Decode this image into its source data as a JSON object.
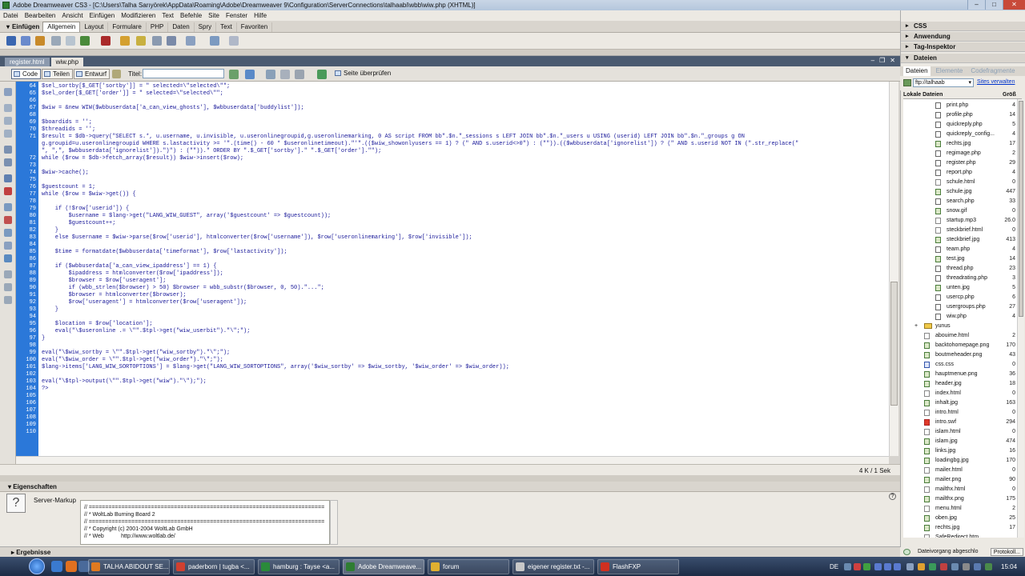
{
  "window": {
    "title": "Adobe Dreamweaver CS3 - [C:\\Users\\Talha Sarıyörek\\AppData\\Roaming\\Adobe\\Dreamweaver 9\\Configuration\\ServerConnections\\talhaabi\\wbb\\wiw.php (XHTML)]"
  },
  "menu": [
    "Datei",
    "Bearbeiten",
    "Ansicht",
    "Einfügen",
    "Modifizieren",
    "Text",
    "Befehle",
    "Site",
    "Fenster",
    "Hilfe"
  ],
  "insertbar": {
    "title": "Einfügen",
    "tabs": [
      "Allgemein",
      "Layout",
      "Formulare",
      "PHP",
      "Daten",
      "Spry",
      "Text",
      "Favoriten"
    ],
    "active": "Allgemein"
  },
  "doctabs": [
    "register.html",
    "wiw.php"
  ],
  "doctoolbar": {
    "code": "Code",
    "split": "Teilen",
    "design": "Entwurf",
    "title_label": "Titel:",
    "check": "Seite überprüfen"
  },
  "editor": {
    "line_numbers": [
      "64",
      "65",
      "66",
      "67",
      "68",
      "69",
      "70",
      "71",
      "",
      "",
      "72",
      "73",
      "74",
      "75",
      "76",
      "77",
      "78",
      "79",
      "80",
      "81",
      "82",
      "83",
      "84",
      "85",
      "86",
      "87",
      "88",
      "89",
      "90",
      "91",
      "92",
      "93",
      "94",
      "95",
      "96",
      "97",
      "98",
      "99",
      "100",
      "101",
      "102",
      "103",
      "104",
      "105",
      "106",
      "107",
      "108",
      "109",
      "110"
    ],
    "lines": [
      "$sel_sortby[$_GET['sortby']] = \" selected=\\\"selected\\\"\";",
      "$sel_order[$_GET['order']] = \" selected=\\\"selected\\\"\";",
      "",
      "$wiw = &new WIW($wbbuserdata['a_can_view_ghosts'], $wbbuserdata['buddylist']);",
      "",
      "$boardids = '';",
      "$threadids = '';",
      "$result = $db->query(\"SELECT s.*, u.username, u.invisible, u.useronlinegroupid,g.useronlinemarking, 0 AS script FROM bb\".$n.\"_sessions s LEFT JOIN bb\".$n.\"_users u USING (userid) LEFT JOIN bb\".$n.\"_groups g ON",
      "g.groupid=u.useronlinegroupid WHERE s.lastactivity >= '\".(time() - 60 * $useronlinetimeout).\"'\".(($wiw_showonlyusers == 1) ? (\" AND s.userid<>0\") : (\"\")).(($wbbuserdata['ignorelist']) ? (\" AND s.userid NOT IN (\".str_replace(\"",
      "\", \",\", $wbbuserdata['ignorelist']).\")\") : (\"\")).\" ORDER BY \".$_GET['sortby'].\" \".$_GET['order'].\"\");",
      "while ($row = $db->fetch_array($result)) $wiw->insert($row);",
      "",
      "$wiw->cache();",
      "",
      "$guestcount = 1;",
      "while ($row = $wiw->get()) {",
      "",
      "    if (!$row['userid']) {",
      "        $username = $lang->get(\"LANG_WIW_GUEST\", array('$guestcount' => $guestcount));",
      "        $guestcount++;",
      "    }",
      "    else $username = $wiw->parse($row['userid'], htmlconverter($row['username']), $row['useronlinemarking'], $row['invisible']);",
      "",
      "    $time = formatdate($wbbuserdata['timeformat'], $row['lastactivity']);",
      "",
      "    if ($wbbuserdata['a_can_view_ipaddress'] == 1) {",
      "        $ipaddress = htmlconverter($row['ipaddress']);",
      "        $browser = $row['useragent'];",
      "        if (wbb_strlen($browser) > 50) $browser = wbb_substr($browser, 0, 50).\"...\";",
      "        $browser = htmlconverter($browser);",
      "        $row['useragent'] = htmlconverter($row['useragent']);",
      "    }",
      "",
      "    $location = $row['location'];",
      "    eval(\"\\$useronline .= \\\"\".$tpl->get(\"wiw_userbit\").\"\\\";\");",
      "}",
      "",
      "eval(\"\\$wiw_sortby = \\\"\".$tpl->get(\"wiw_sortby\").\"\\\";\");",
      "eval(\"\\$wiw_order = \\\"\".$tpl->get(\"wiw_order\").\"\\\";\");",
      "$lang->items['LANG_WIW_SORTOPTIONS'] = $lang->get(\"LANG_WIW_SORTOPTIONS\", array('$wiw_sortby' => $wiw_sortby, '$wiw_order' => $wiw_order));",
      "",
      "eval(\"\\$tpl->output(\\\"\".$tpl->get(\"wiw\").\"\\\");\");",
      "?>"
    ],
    "status": "4 K / 1 Sek"
  },
  "properties": {
    "title": "Eigenschaften",
    "server_markup": "Server-Markup",
    "snippet": [
      "// ========================================================================",
      "// * WoltLab Burning Board 2",
      "// ========================================================================",
      "// * Copyright (c) 2001-2004 WoltLab GmbH",
      "// * Web           http://www.woltlab.de/"
    ]
  },
  "results": "Ergebnisse",
  "rightpanel": {
    "groups": [
      "CSS",
      "Anwendung",
      "Tag-Inspektor",
      "Dateien"
    ],
    "file_tabs": [
      "Dateien",
      "Elemente",
      "Codefragmente"
    ],
    "site": "ftp://talhaab",
    "site_link": "Sites verwalten",
    "columns": [
      "Lokale Dateien",
      "Größ"
    ],
    "files": [
      {
        "name": "print.php",
        "size": "4",
        "type": "php",
        "indent": 2
      },
      {
        "name": "profile.php",
        "size": "14",
        "type": "php",
        "indent": 2
      },
      {
        "name": "quickreply.php",
        "size": "5",
        "type": "php",
        "indent": 2
      },
      {
        "name": "quickreply_config...",
        "size": "4",
        "type": "php",
        "indent": 2
      },
      {
        "name": "rechts.jpg",
        "size": "17",
        "type": "img",
        "indent": 2
      },
      {
        "name": "regimage.php",
        "size": "2",
        "type": "php",
        "indent": 2
      },
      {
        "name": "register.php",
        "size": "29",
        "type": "php",
        "indent": 2
      },
      {
        "name": "report.php",
        "size": "4",
        "type": "php",
        "indent": 2
      },
      {
        "name": "schule.html",
        "size": "0",
        "type": "html",
        "indent": 2
      },
      {
        "name": "schule.jpg",
        "size": "447",
        "type": "img",
        "indent": 2
      },
      {
        "name": "search.php",
        "size": "33",
        "type": "php",
        "indent": 2
      },
      {
        "name": "snow.gif",
        "size": "0",
        "type": "img",
        "indent": 2
      },
      {
        "name": "startup.mp3",
        "size": "26.0",
        "type": "html",
        "indent": 2
      },
      {
        "name": "steckbrief.html",
        "size": "0",
        "type": "html",
        "indent": 2
      },
      {
        "name": "steckbrief.jpg",
        "size": "413",
        "type": "img",
        "indent": 2
      },
      {
        "name": "team.php",
        "size": "4",
        "type": "php",
        "indent": 2
      },
      {
        "name": "test.jpg",
        "size": "14",
        "type": "img",
        "indent": 2
      },
      {
        "name": "thread.php",
        "size": "23",
        "type": "php",
        "indent": 2
      },
      {
        "name": "threadrating.php",
        "size": "3",
        "type": "php",
        "indent": 2
      },
      {
        "name": "unten.jpg",
        "size": "5",
        "type": "img",
        "indent": 2
      },
      {
        "name": "usercp.php",
        "size": "6",
        "type": "php",
        "indent": 2
      },
      {
        "name": "usergroups.php",
        "size": "27",
        "type": "php",
        "indent": 2
      },
      {
        "name": "wiw.php",
        "size": "4",
        "type": "php",
        "indent": 2
      },
      {
        "name": "yunus",
        "size": "",
        "type": "folder",
        "indent": 1
      },
      {
        "name": "abouime.html",
        "size": "2",
        "type": "html",
        "indent": 1
      },
      {
        "name": "backtohomepage.png",
        "size": "170",
        "type": "img",
        "indent": 1
      },
      {
        "name": "boutmeheader.png",
        "size": "43",
        "type": "img",
        "indent": 1
      },
      {
        "name": "css.css",
        "size": "0",
        "type": "css",
        "indent": 1
      },
      {
        "name": "hauptmenue.png",
        "size": "36",
        "type": "img",
        "indent": 1
      },
      {
        "name": "header.jpg",
        "size": "18",
        "type": "img",
        "indent": 1
      },
      {
        "name": "index.html",
        "size": "0",
        "type": "html",
        "indent": 1
      },
      {
        "name": "inhalt.jpg",
        "size": "163",
        "type": "img",
        "indent": 1
      },
      {
        "name": "intro.html",
        "size": "0",
        "type": "html",
        "indent": 1
      },
      {
        "name": "intro.swf",
        "size": "294",
        "type": "fl",
        "indent": 1
      },
      {
        "name": "islam.html",
        "size": "0",
        "type": "html",
        "indent": 1
      },
      {
        "name": "islam.jpg",
        "size": "474",
        "type": "img",
        "indent": 1
      },
      {
        "name": "links.jpg",
        "size": "16",
        "type": "img",
        "indent": 1
      },
      {
        "name": "loadingbg.jpg",
        "size": "170",
        "type": "img",
        "indent": 1
      },
      {
        "name": "mailer.html",
        "size": "0",
        "type": "html",
        "indent": 1
      },
      {
        "name": "mailer.png",
        "size": "90",
        "type": "img",
        "indent": 1
      },
      {
        "name": "mailthx.html",
        "size": "0",
        "type": "html",
        "indent": 1
      },
      {
        "name": "mailthx.png",
        "size": "175",
        "type": "img",
        "indent": 1
      },
      {
        "name": "menu.html",
        "size": "2",
        "type": "html",
        "indent": 1
      },
      {
        "name": "oben.jpg",
        "size": "25",
        "type": "img",
        "indent": 1
      },
      {
        "name": "rechts.jpg",
        "size": "17",
        "type": "img",
        "indent": 1
      },
      {
        "name": "SafeRedirect.htm",
        "size": "",
        "type": "html",
        "indent": 1
      }
    ],
    "status": "Dateivorgang abgeschlo",
    "protocol_button": "Protokoll..."
  },
  "taskbar": {
    "tasks": [
      {
        "label": "TALHA ABIDOUT SE...",
        "color": "#e07a20"
      },
      {
        "label": "paderborn | tugba <...",
        "color": "#d04030"
      },
      {
        "label": "hamburg : Tayse <a...",
        "color": "#2a8a3a"
      },
      {
        "label": "Adobe Dreamweave...",
        "color": "#2e7d32"
      },
      {
        "label": "forum",
        "color": "#e0b030"
      },
      {
        "label": "eigener register.txt -...",
        "color": "#c8c8c8"
      },
      {
        "label": "FlashFXP",
        "color": "#d03020"
      }
    ],
    "language": "DE",
    "clock": "15:04"
  }
}
